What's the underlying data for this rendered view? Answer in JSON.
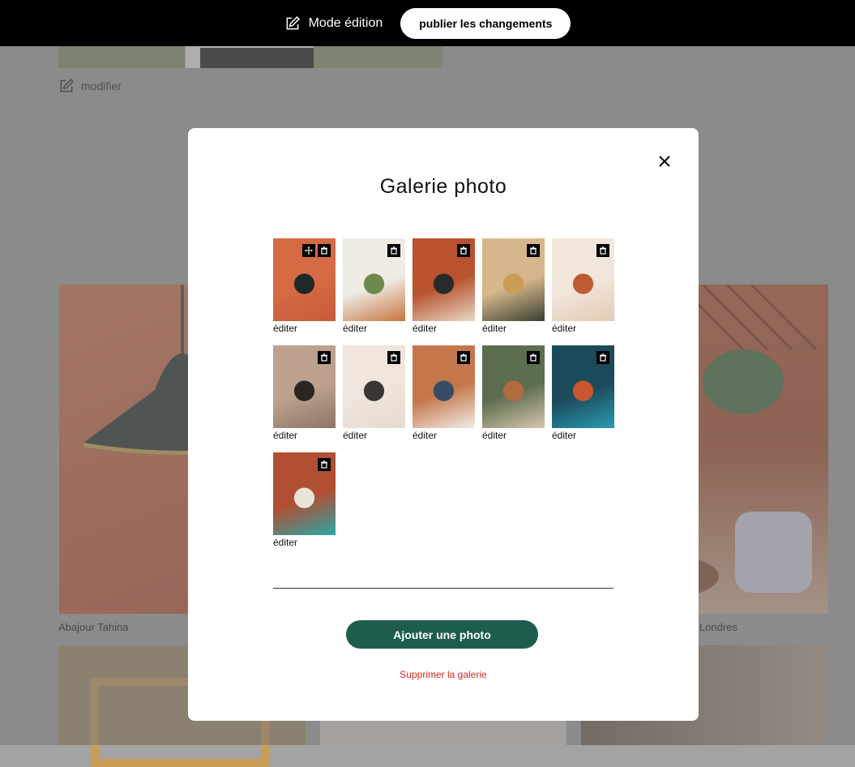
{
  "topbar": {
    "mode_label": "Mode édition",
    "publish_label": "publier les changements"
  },
  "background": {
    "modify_label": "modifier",
    "captions": [
      "Abajour Tahina",
      "Londres"
    ]
  },
  "modal": {
    "title": "Galerie photo",
    "edit_label": "éditer",
    "photos": [
      {
        "colors": [
          "#d66a45",
          "#c85a38"
        ],
        "accent": "#1f2a28"
      },
      {
        "colors": [
          "#efece6",
          "#c4763f"
        ],
        "accent": "#6b8a4c"
      },
      {
        "colors": [
          "#b8532e",
          "#e8d8c8"
        ],
        "accent": "#2a2a2a"
      },
      {
        "colors": [
          "#d6b78b",
          "#3a3f33"
        ],
        "accent": "#c99d58"
      },
      {
        "colors": [
          "#f1e6da",
          "#e1cbb5"
        ],
        "accent": "#bd5b33"
      },
      {
        "colors": [
          "#bda18e",
          "#8d7466"
        ],
        "accent": "#2a2522"
      },
      {
        "colors": [
          "#efe5dc",
          "#e7dbd1"
        ],
        "accent": "#3b3532"
      },
      {
        "colors": [
          "#c5774c",
          "#f1ede9"
        ],
        "accent": "#344d63"
      },
      {
        "colors": [
          "#5d6d50",
          "#d8c6ac"
        ],
        "accent": "#b06c3f"
      },
      {
        "colors": [
          "#1b4a5a",
          "#2b9bb2"
        ],
        "accent": "#c9562c"
      },
      {
        "colors": [
          "#b04f34",
          "#2aa7a6"
        ],
        "accent": "#e9e4dc"
      }
    ],
    "add_label": "Ajouter une photo",
    "delete_label": "Supprimer la galerie"
  },
  "colors": {
    "accent": "#1e5d4d",
    "danger": "#d2281f",
    "topbar": "#000000"
  },
  "icons": {
    "mode": "pencil-square-icon",
    "modify": "pencil-square-icon",
    "close": "close-icon",
    "move": "move-icon",
    "trash": "trash-icon"
  }
}
